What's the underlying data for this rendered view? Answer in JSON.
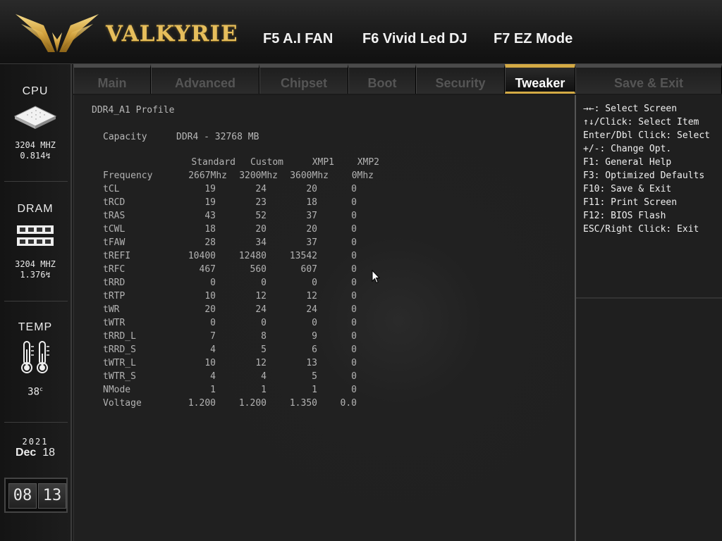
{
  "header": {
    "brand": "VALKYRIE",
    "hotkeys": [
      {
        "label": "F5 A.I FAN"
      },
      {
        "label": "F6 Vivid Led DJ"
      },
      {
        "label": "F7 EZ Mode"
      }
    ]
  },
  "sidebar": {
    "cpu": {
      "title": "CPU",
      "freq": "3204 MHZ",
      "volt": "0.814"
    },
    "dram": {
      "title": "DRAM",
      "freq": "3204 MHZ",
      "volt": "1.376"
    },
    "temp": {
      "title": "TEMP",
      "value": "38",
      "unit": "c"
    },
    "date": {
      "year": "2021",
      "month": "Dec",
      "day": "18"
    },
    "clock": {
      "hour": "08",
      "minute": "13"
    }
  },
  "tabs": [
    {
      "label": "Main"
    },
    {
      "label": "Advanced"
    },
    {
      "label": "Chipset"
    },
    {
      "label": "Boot"
    },
    {
      "label": "Security"
    },
    {
      "label": "Tweaker",
      "active": true
    },
    {
      "label": "Save & Exit"
    }
  ],
  "profile": {
    "title": "DDR4_A1 Profile",
    "capacity_label": "Capacity",
    "capacity_value": "DDR4 - 32768 MB",
    "columns": [
      "Standard",
      "Custom",
      "XMP1",
      "XMP2"
    ],
    "rows": [
      {
        "name": "Frequency",
        "values": [
          "2667Mhz",
          "3200Mhz",
          "3600Mhz",
          "0Mhz"
        ]
      },
      {
        "name": "tCL",
        "values": [
          "19",
          "24",
          "20",
          "0"
        ]
      },
      {
        "name": "tRCD",
        "values": [
          "19",
          "23",
          "18",
          "0"
        ]
      },
      {
        "name": "tRAS",
        "values": [
          "43",
          "52",
          "37",
          "0"
        ]
      },
      {
        "name": "tCWL",
        "values": [
          "18",
          "20",
          "20",
          "0"
        ]
      },
      {
        "name": "tFAW",
        "values": [
          "28",
          "34",
          "37",
          "0"
        ]
      },
      {
        "name": "tREFI",
        "values": [
          "10400",
          "12480",
          "13542",
          "0"
        ]
      },
      {
        "name": "tRFC",
        "values": [
          "467",
          "560",
          "607",
          "0"
        ]
      },
      {
        "name": "tRRD",
        "values": [
          "0",
          "0",
          "0",
          "0"
        ]
      },
      {
        "name": "tRTP",
        "values": [
          "10",
          "12",
          "12",
          "0"
        ]
      },
      {
        "name": "tWR",
        "values": [
          "20",
          "24",
          "24",
          "0"
        ]
      },
      {
        "name": "tWTR",
        "values": [
          "0",
          "0",
          "0",
          "0"
        ]
      },
      {
        "name": "tRRD_L",
        "values": [
          "7",
          "8",
          "9",
          "0"
        ]
      },
      {
        "name": "tRRD_S",
        "values": [
          "4",
          "5",
          "6",
          "0"
        ]
      },
      {
        "name": "tWTR_L",
        "values": [
          "10",
          "12",
          "13",
          "0"
        ]
      },
      {
        "name": "tWTR_S",
        "values": [
          "4",
          "4",
          "5",
          "0"
        ]
      },
      {
        "name": "NMode",
        "values": [
          "1",
          "1",
          "1",
          "0"
        ]
      },
      {
        "name": "Voltage",
        "values": [
          "1.200",
          "1.200",
          "1.350",
          "0.0"
        ]
      }
    ]
  },
  "help": [
    "→←: Select Screen",
    "↑↓/Click: Select Item",
    "Enter/Dbl Click: Select",
    "+/-: Change Opt.",
    "F1: General Help",
    "F3: Optimized Defaults",
    "F10: Save & Exit",
    "F11: Print Screen",
    "F12: BIOS Flash",
    "ESC/Right Click: Exit"
  ],
  "colors": {
    "accent": "#d4aa45",
    "background": "#1b1b1b",
    "text": "#b8b8b8"
  }
}
